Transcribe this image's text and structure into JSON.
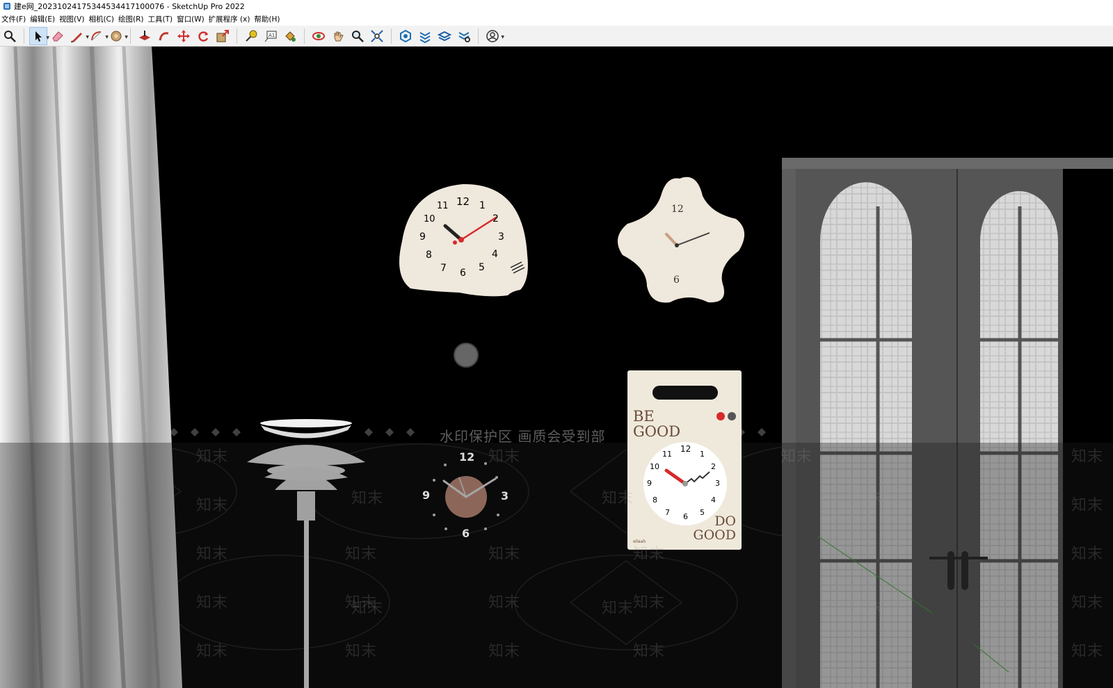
{
  "window": {
    "title": "建e网_20231024175344534417100076 - SketchUp Pro 2022"
  },
  "menu": [
    {
      "label": "文件(F)"
    },
    {
      "label": "编辑(E)"
    },
    {
      "label": "视图(V)"
    },
    {
      "label": "相机(C)"
    },
    {
      "label": "绘图(R)"
    },
    {
      "label": "工具(T)"
    },
    {
      "label": "窗口(W)"
    },
    {
      "label": "扩展程序 (x)"
    },
    {
      "label": "帮助(H)"
    }
  ],
  "toolbar": {
    "tools": [
      {
        "icon": "zoom-window-icon"
      },
      {
        "icon": "select-arrow-icon",
        "active": true
      },
      {
        "icon": "eraser-icon"
      },
      {
        "icon": "pencil-line-icon"
      },
      {
        "icon": "arc-icon"
      },
      {
        "icon": "paint-bucket-icon"
      },
      {
        "icon": "push-pull-icon"
      },
      {
        "icon": "follow-me-icon"
      },
      {
        "icon": "move-icon"
      },
      {
        "icon": "rotate-icon"
      },
      {
        "icon": "scale-icon"
      },
      {
        "icon": "tape-measure-icon"
      },
      {
        "icon": "text-icon"
      },
      {
        "icon": "paint-icon"
      },
      {
        "icon": "orbit-icon"
      },
      {
        "icon": "pan-hand-icon"
      },
      {
        "icon": "zoom-icon"
      },
      {
        "icon": "zoom-extents-icon"
      },
      {
        "icon": "3d-warehouse-icon"
      },
      {
        "icon": "extension-warehouse-icon"
      },
      {
        "icon": "layout-icon"
      },
      {
        "icon": "extension-manager-icon"
      },
      {
        "icon": "account-icon"
      }
    ],
    "text_tool_label": "A1"
  },
  "scene": {
    "watermark_banner": "水印保护区   画质会受到部",
    "watermark_word": "知末",
    "watermark_word_alt": "知末",
    "clock1_numbers": [
      "12",
      "1",
      "2",
      "3",
      "4",
      "5",
      "6",
      "7",
      "8",
      "9",
      "10",
      "11"
    ],
    "clock2_numbers": [
      "12",
      "6"
    ],
    "clock3_numbers": [
      "12",
      "3",
      "6",
      "9"
    ],
    "poster": {
      "line1": "BE",
      "line2": "GOOD",
      "line3": "DO",
      "line4": "GOOD",
      "brand": "ellaah",
      "clock_numbers": [
        "12",
        "1",
        "2",
        "3",
        "4",
        "5",
        "6",
        "7",
        "8",
        "9",
        "10",
        "11"
      ]
    },
    "colors": {
      "background": "#000000",
      "clock_face": "#efe8dc",
      "hand_red": "#d62a2a",
      "door_frame": "#5a5a5a",
      "curtain": "#e6e6e6"
    }
  }
}
